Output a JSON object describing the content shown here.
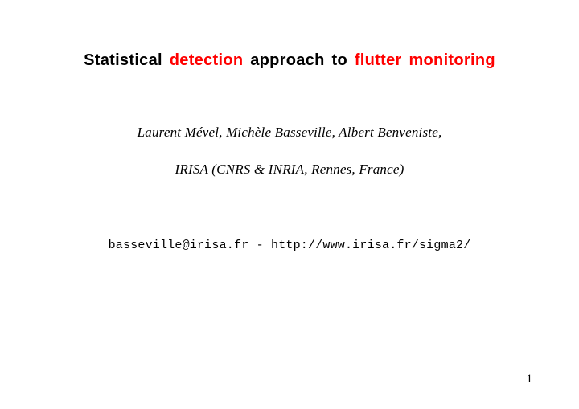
{
  "title": {
    "part1": "Statistical",
    "part2": "detection",
    "part3": "approach to",
    "part4": "flutter monitoring"
  },
  "authors": "Laurent Mével, Michèle Basseville, Albert Benveniste,",
  "affiliation": "IRISA (CNRS & INRIA, Rennes, France)",
  "contact": "basseville@irisa.fr - http://www.irisa.fr/sigma2/",
  "page_number": "1"
}
